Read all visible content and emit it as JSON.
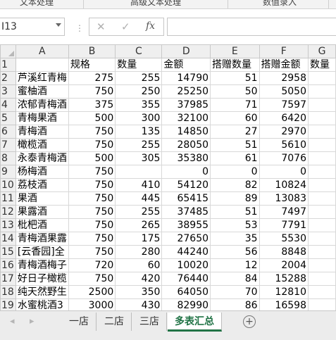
{
  "ribbon": {
    "groups": [
      "文本处理",
      "高级文本处理",
      "数值录入"
    ]
  },
  "formula_bar": {
    "name_box": "I13",
    "cancel_icon": "✕",
    "enter_icon": "✓",
    "function_icon": "fx",
    "formula_value": ""
  },
  "columns": [
    "A",
    "B",
    "C",
    "D",
    "E",
    "F",
    "G"
  ],
  "header_row": {
    "row": "1",
    "cells": [
      "",
      "规格",
      "数量",
      "金额",
      "搭赠数量",
      "搭赠金额",
      "数量"
    ]
  },
  "rows": [
    {
      "row": "2",
      "cells": [
        "芦溪红青梅",
        "275",
        "255",
        "14790",
        "51",
        "2958",
        ""
      ]
    },
    {
      "row": "3",
      "cells": [
        "蜜柚酒",
        "750",
        "250",
        "25250",
        "50",
        "5050",
        ""
      ]
    },
    {
      "row": "4",
      "cells": [
        "浓郁青梅酒",
        "375",
        "355",
        "37985",
        "71",
        "7597",
        ""
      ]
    },
    {
      "row": "5",
      "cells": [
        "青梅果酒",
        "500",
        "300",
        "32100",
        "60",
        "6420",
        ""
      ]
    },
    {
      "row": "6",
      "cells": [
        "青梅酒",
        "750",
        "135",
        "14850",
        "27",
        "2970",
        ""
      ]
    },
    {
      "row": "7",
      "cells": [
        "橄榄酒",
        "750",
        "255",
        "28050",
        "51",
        "5610",
        ""
      ]
    },
    {
      "row": "8",
      "cells": [
        "永泰青梅酒",
        "500",
        "305",
        "35380",
        "61",
        "7076",
        ""
      ]
    },
    {
      "row": "9",
      "cells": [
        "杨梅酒",
        "750",
        "",
        "0",
        "0",
        "0",
        ""
      ]
    },
    {
      "row": "10",
      "cells": [
        "荔枝酒",
        "750",
        "410",
        "54120",
        "82",
        "10824",
        ""
      ]
    },
    {
      "row": "11",
      "cells": [
        "果酒",
        "750",
        "445",
        "65415",
        "89",
        "13083",
        ""
      ]
    },
    {
      "row": "12",
      "cells": [
        "果露酒",
        "750",
        "255",
        "37485",
        "51",
        "7497",
        ""
      ]
    },
    {
      "row": "13",
      "cells": [
        "枇杷酒",
        "750",
        "265",
        "38955",
        "53",
        "7791",
        ""
      ]
    },
    {
      "row": "14",
      "cells": [
        "青梅酒果露",
        "750",
        "175",
        "27650",
        "35",
        "5530",
        ""
      ]
    },
    {
      "row": "15",
      "cells": [
        "[云香园]全",
        "750",
        "280",
        "44240",
        "56",
        "8848",
        ""
      ]
    },
    {
      "row": "16",
      "cells": [
        "青梅酒梅子",
        "720",
        "60",
        "10020",
        "12",
        "2004",
        ""
      ]
    },
    {
      "row": "17",
      "cells": [
        "好日子橄榄",
        "750",
        "420",
        "76440",
        "84",
        "15288",
        ""
      ]
    },
    {
      "row": "18",
      "cells": [
        "纯天然野生",
        "2500",
        "350",
        "64050",
        "70",
        "12810",
        ""
      ]
    },
    {
      "row": "19",
      "cells": [
        "水蜜桃酒3",
        "3000",
        "430",
        "82990",
        "86",
        "16598",
        ""
      ]
    }
  ],
  "sheet_tabs": [
    "一店",
    "二店",
    "三店",
    "多表汇总"
  ],
  "active_tab": "多表汇总",
  "add_sheet_icon": "+",
  "colors": {
    "accent": "#217346",
    "header_bg": "#efefef",
    "grid_line": "#d8d8d8"
  }
}
